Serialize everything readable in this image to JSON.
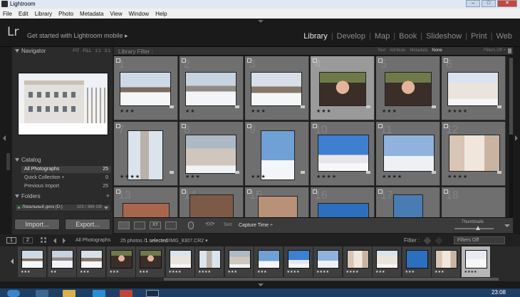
{
  "window": {
    "title": "Lightroom"
  },
  "menu": [
    "File",
    "Edit",
    "Library",
    "Photo",
    "Metadata",
    "View",
    "Window",
    "Help"
  ],
  "identity": {
    "logo": "Lr",
    "get_started": "Get started with Lightroom mobile  ▸"
  },
  "modules": [
    {
      "label": "Library",
      "active": true
    },
    {
      "label": "Develop",
      "active": false
    },
    {
      "label": "Map",
      "active": false
    },
    {
      "label": "Book",
      "active": false
    },
    {
      "label": "Slideshow",
      "active": false
    },
    {
      "label": "Print",
      "active": false
    },
    {
      "label": "Web",
      "active": false
    }
  ],
  "navigator": {
    "title": "Navigator",
    "zoom": [
      "FIT",
      "FILL",
      "1:1",
      "3:1"
    ]
  },
  "catalog": {
    "title": "Catalog",
    "items": [
      {
        "label": "All Photographs",
        "count": "25",
        "selected": true
      },
      {
        "label": "Quick Collection  +",
        "count": "0",
        "selected": false
      },
      {
        "label": "Previous Import",
        "count": "25",
        "selected": false
      }
    ]
  },
  "folders": {
    "title": "Folders",
    "plus": "+",
    "disk_label": "Локальный диск (D:)",
    "disk_size": "103 / 366 GB"
  },
  "buttons": {
    "import": "Import...",
    "export": "Export..."
  },
  "filter": {
    "label": "Library Filter :",
    "tabs": [
      "Text",
      "Attribute",
      "Metadata",
      "None"
    ],
    "active_tab": "None",
    "filters_off": "Filters Off ÷"
  },
  "grid": [
    {
      "idx": "1",
      "stars": "★★★",
      "scene": "snowpark"
    },
    {
      "idx": "2",
      "stars": "★★",
      "scene": "snowpark2"
    },
    {
      "idx": "3",
      "stars": "★★★",
      "scene": "snowpark3"
    },
    {
      "idx": "4",
      "stars": "★★★",
      "scene": "portrait"
    },
    {
      "idx": "5",
      "stars": "★★★",
      "scene": "portrait"
    },
    {
      "idx": "6",
      "stars": "★★★★",
      "scene": "building"
    },
    {
      "idx": "7",
      "stars": "★★★★",
      "scene": "tower"
    },
    {
      "idx": "8",
      "stars": "★★★",
      "scene": "tower2"
    },
    {
      "idx": "9",
      "stars": "★★★",
      "scene": "monument"
    },
    {
      "idx": "10",
      "stars": "★★★★",
      "scene": "mosque"
    },
    {
      "idx": "11",
      "stars": "★★★★",
      "scene": "monument2"
    },
    {
      "idx": "12",
      "stars": "★★★★",
      "scene": "arcade"
    },
    {
      "idx": "13",
      "stars": "",
      "scene": "interior"
    },
    {
      "idx": "14",
      "stars": "",
      "scene": "arch"
    },
    {
      "idx": "15",
      "stars": "",
      "scene": "arch2"
    },
    {
      "idx": "16",
      "stars": "",
      "scene": "sky"
    },
    {
      "idx": "17",
      "stars": "",
      "scene": "sign"
    },
    {
      "idx": "18",
      "stars": "",
      "scene": "blank"
    }
  ],
  "toolbar": {
    "sort_label": "Sort:",
    "sort_value": "Capture Time ÷",
    "thumbs_label": "Thumbnails"
  },
  "filmstrip_header": {
    "screen1": "1",
    "screen2": "2",
    "source": "All Photographs",
    "count_prefix": "25 photos /",
    "count_sel": "1 selected",
    "count_file": "/IMG_8307.CR2 ▾",
    "filter_label": "Filter :",
    "filters_off": "Filters Off"
  },
  "filmstrip": [
    {
      "stars": "★★★",
      "scene": "snowpark"
    },
    {
      "stars": "★★",
      "scene": "snowpark2"
    },
    {
      "stars": "★★★",
      "scene": "snowpark3"
    },
    {
      "stars": "★★★",
      "scene": "portrait"
    },
    {
      "stars": "★★★",
      "scene": "portrait"
    },
    {
      "stars": "★★★★",
      "scene": "building"
    },
    {
      "stars": "★★★★",
      "scene": "tower"
    },
    {
      "stars": "★★★",
      "scene": "tower2"
    },
    {
      "stars": "★★★",
      "scene": "monument"
    },
    {
      "stars": "★★★★",
      "scene": "mosque"
    },
    {
      "stars": "★★★★",
      "scene": "monument2"
    },
    {
      "stars": "★★★★",
      "scene": "arcade"
    },
    {
      "stars": "★★★",
      "scene": "building"
    },
    {
      "stars": "★★★",
      "scene": "sky"
    },
    {
      "stars": "★★★",
      "scene": "arcade"
    },
    {
      "stars": "★★★★",
      "scene": "snowsel",
      "selected": true
    }
  ],
  "taskbar": {
    "time": "23:08"
  }
}
